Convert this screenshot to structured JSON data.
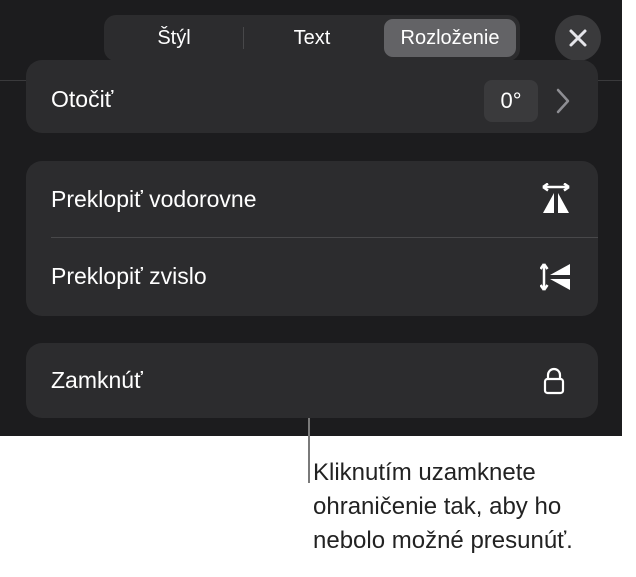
{
  "tabs": [
    {
      "label": "Štýl",
      "active": false
    },
    {
      "label": "Text",
      "active": false
    },
    {
      "label": "Rozloženie",
      "active": true
    }
  ],
  "close_icon": "close-icon",
  "rotate": {
    "label": "Otočiť",
    "value": "0°"
  },
  "flip": {
    "horizontal_label": "Preklopiť vodorovne",
    "vertical_label": "Preklopiť zvislo"
  },
  "lock": {
    "label": "Zamknúť",
    "icon": "lock-icon"
  },
  "callout": {
    "lines": [
      "Kliknutím uzamknete",
      "ohraničenie tak, aby ho",
      "nebolo možné presunúť."
    ]
  },
  "colors": {
    "panel_bg": "#1c1c1e",
    "card_bg": "#2c2c2e",
    "segment_active": "#636366",
    "text_light": "#ffffff",
    "callout_text": "#222222"
  }
}
